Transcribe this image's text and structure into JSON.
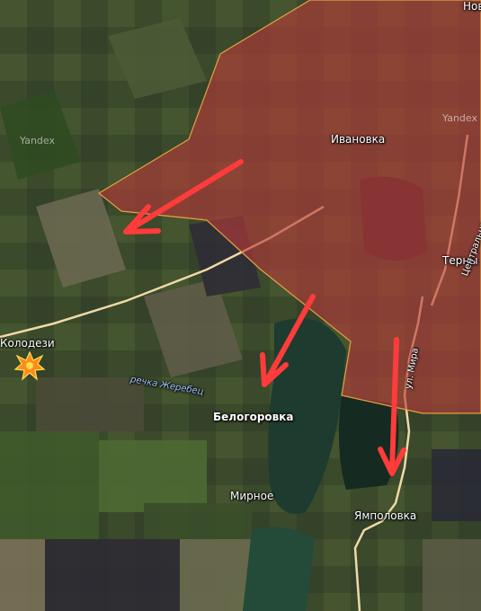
{
  "map": {
    "places": [
      {
        "id": "ivanovka",
        "name": "Ивановка"
      },
      {
        "id": "terny",
        "name": "Терны"
      },
      {
        "id": "nov",
        "name": "Нов"
      },
      {
        "id": "kolodezi",
        "name": "Колодези"
      },
      {
        "id": "belogorovka",
        "name": "Белогоровка"
      },
      {
        "id": "mirnoe",
        "name": "Мирное"
      },
      {
        "id": "yampolovka",
        "name": "Ямполовка"
      }
    ],
    "river_label": "речка Жеребец",
    "streets": [
      {
        "id": "mira",
        "name": "ул. Мира"
      },
      {
        "id": "centralnaya",
        "name": "Центральная ул."
      }
    ],
    "watermarks": [
      "Yandex",
      "Yandex"
    ],
    "colors": {
      "controlled_zone_fill": "#b83a3a",
      "controlled_zone_border": "#e8a040",
      "arrow": "#ff3b3b",
      "road": "#f1d9a6",
      "water": "#1f3a2e"
    },
    "icons": {
      "strike": "explosion-icon"
    }
  }
}
